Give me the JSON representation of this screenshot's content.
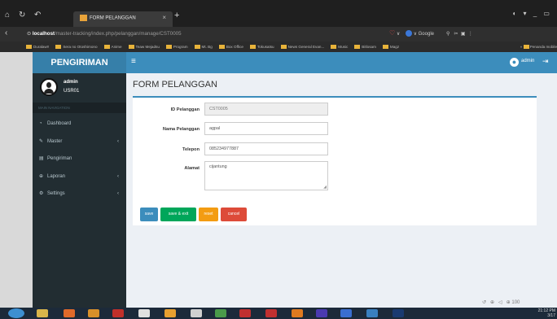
{
  "browser": {
    "tab_title": "FORM PELANGGAN",
    "url_host": "localhost",
    "url_path": "/master-tracking/index.php/pelanggan/manage/CST0005",
    "search_engine": "Google",
    "bookmarks": [
      "Duralaw!!",
      "Sera no Otoshimono",
      "Anime",
      "Teaw Mejadsu",
      "Program",
      "Mt. Bg",
      "Box Office",
      "Tokusatsu",
      "News General Evan...",
      "Music",
      "Bitlosam",
      "Magz"
    ],
    "bookmarks_more": "Penanda mobile"
  },
  "app": {
    "brand": "PENGIRIMAN",
    "top_user": "admin"
  },
  "sidebar": {
    "user_name": "admin",
    "user_code": "USR01",
    "nav_header": "MAIN NAVIGATION",
    "items": [
      {
        "label": "Dashboard",
        "icon": "dashboard-icon",
        "glyph": "◔",
        "has_arrow": false
      },
      {
        "label": "Master",
        "icon": "edit-icon",
        "glyph": "✎",
        "has_arrow": true
      },
      {
        "label": "Pengiriman",
        "icon": "file-icon",
        "glyph": "▤",
        "has_arrow": false
      },
      {
        "label": "Laporan",
        "icon": "report-icon",
        "glyph": "⊕",
        "has_arrow": true
      },
      {
        "label": "Settings",
        "icon": "cogs-icon",
        "glyph": "⚙",
        "has_arrow": true
      }
    ]
  },
  "page": {
    "title": "FORM PELANGGAN"
  },
  "form": {
    "id_label": "ID Pelanggan",
    "id_value": "CST0005",
    "nama_label": "Nama Pelanggan",
    "nama_value": "agpal",
    "telepon_label": "Telepon",
    "telepon_value": "085234977887",
    "alamat_label": "Alamat",
    "alamat_value": "cijantung"
  },
  "buttons": {
    "save": "save",
    "save_exit": "save & exit",
    "reset": "reset",
    "cancel": "cancel"
  },
  "colors": {
    "header": "#3c8dbc",
    "sidebar": "#222d32",
    "save": "#3c8dbc",
    "save_exit": "#00a65a",
    "reset": "#f39c12",
    "cancel": "#dd4b39"
  },
  "taskbar": {
    "time": "21:12 PM",
    "date": "3/17"
  }
}
